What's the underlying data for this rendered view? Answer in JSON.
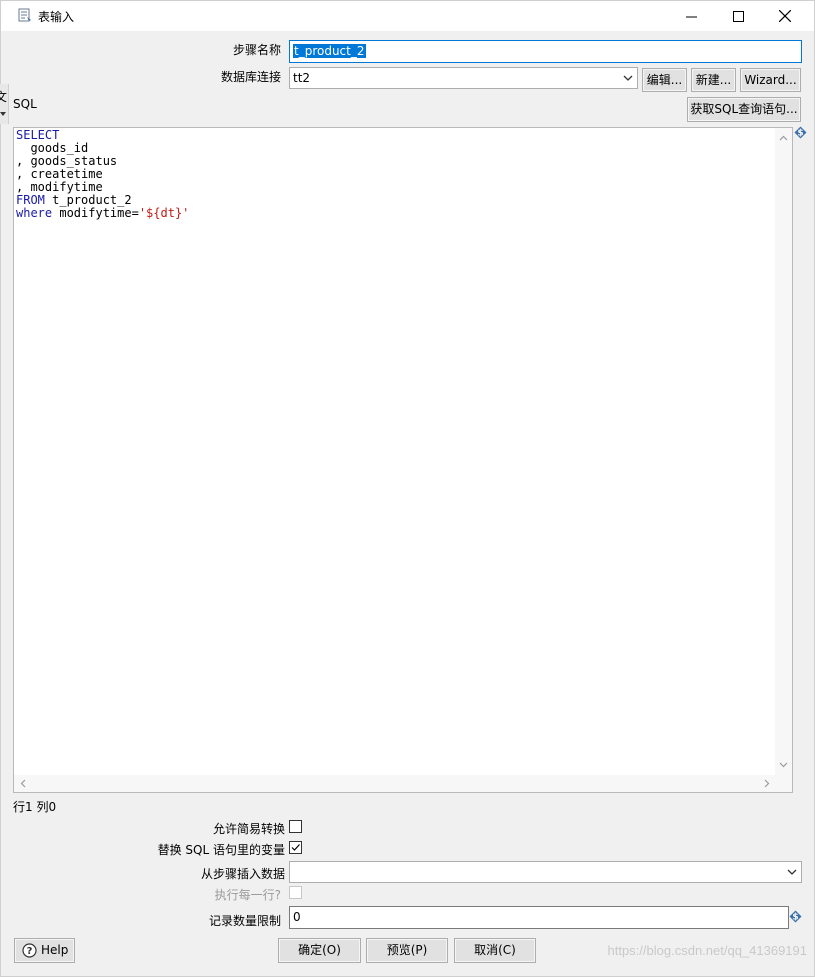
{
  "window": {
    "title": "表输入"
  },
  "background_fragment": {
    "text": "文"
  },
  "step_name": {
    "label": "步骤名称",
    "value": "t_product_2"
  },
  "connection": {
    "label": "数据库连接",
    "value": "tt2",
    "edit_label": "编辑...",
    "new_label": "新建...",
    "wizard_label": "Wizard..."
  },
  "sql": {
    "label": "SQL",
    "get_sql_label": "获取SQL查询语句...",
    "lines": [
      {
        "kw": "SELECT",
        "rest": ""
      },
      {
        "kw": "",
        "rest": "  goods_id"
      },
      {
        "kw": "",
        "rest": ", goods_status"
      },
      {
        "kw": "",
        "rest": ", createtime"
      },
      {
        "kw": "",
        "rest": ", modifytime"
      },
      {
        "kw": "FROM",
        "rest": " t_product_2"
      },
      {
        "kw": "where",
        "rest": " modifytime=",
        "str": "'${dt}'"
      }
    ]
  },
  "cursor_position": "行1 列0",
  "options": {
    "lazy_conversion_label": "允许简易转换",
    "lazy_conversion_checked": false,
    "replace_vars_label": "替换 SQL 语句里的变量",
    "replace_vars_checked": true,
    "insert_from_step_label": "从步骤插入数据",
    "insert_from_step_value": "",
    "execute_each_row_label": "执行每一行?",
    "execute_each_row_checked": false,
    "limit_label": "记录数量限制",
    "limit_value": "0"
  },
  "footer": {
    "help_label": "Help",
    "ok_label": "确定(O)",
    "preview_label": "预览(P)",
    "cancel_label": "取消(C)"
  },
  "watermark": "https://blog.csdn.net/qq_41369191",
  "colors": {
    "keyword": "#1a1aa6",
    "string": "#c41a16",
    "selection": "#0078d7",
    "variable_icon": "#3d6fa8"
  }
}
